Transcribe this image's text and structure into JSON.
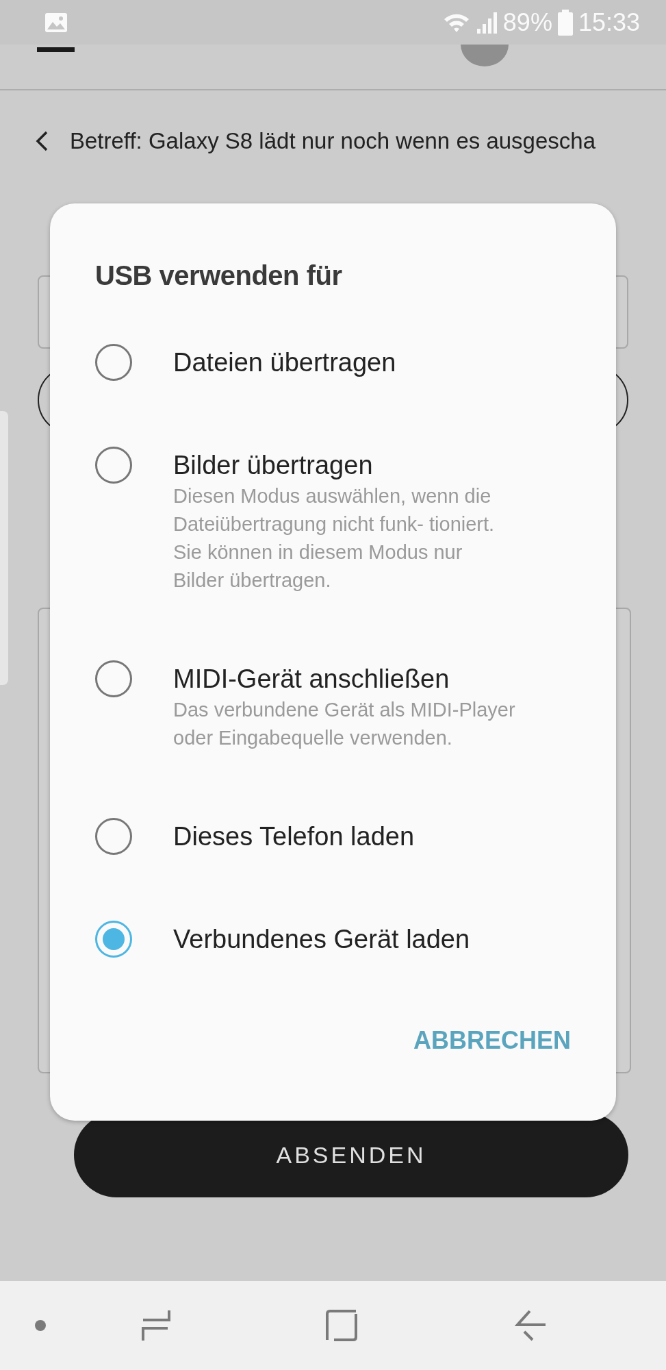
{
  "status_bar": {
    "battery": "89%",
    "time": "15:33"
  },
  "subject": {
    "text": "Betreff: Galaxy S8 lädt nur noch wenn es ausgescha"
  },
  "dialog": {
    "title": "USB verwenden für",
    "options": [
      {
        "label": "Dateien übertragen",
        "selected": false
      },
      {
        "label": "Bilder übertragen",
        "description": "Diesen Modus auswählen, wenn die Dateiübertragung nicht funk- tioniert. Sie können in diesem Modus nur Bilder übertragen.",
        "selected": false
      },
      {
        "label": "MIDI-Gerät anschließen",
        "description": "Das verbundene Gerät als MIDI-Player oder Eingabequelle verwenden.",
        "selected": false
      },
      {
        "label": "Dieses Telefon laden",
        "selected": false
      },
      {
        "label": "Verbundenes Gerät laden",
        "selected": true
      }
    ],
    "cancel": "ABBRECHEN"
  },
  "send_button": "ABSENDEN"
}
